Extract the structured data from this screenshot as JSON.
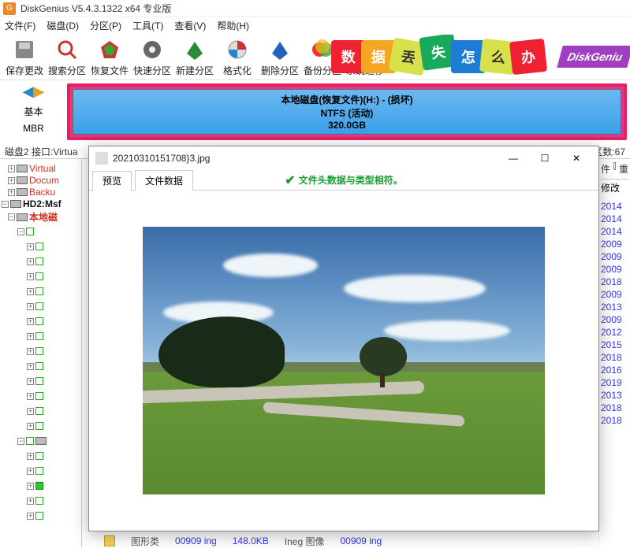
{
  "app": {
    "title": "DiskGenius V5.4.3.1322 x64 专业版"
  },
  "menu": {
    "file": "文件(F)",
    "disk": "磁盘(D)",
    "part": "分区(P)",
    "tool": "工具(T)",
    "view": "查看(V)",
    "help": "帮助(H)"
  },
  "toolbar": {
    "save": "保存更改",
    "search": "搜索分区",
    "recover": "恢复文件",
    "quick": "快速分区",
    "newp": "新建分区",
    "format": "格式化",
    "delete": "删除分区",
    "backup": "备份分区",
    "migrate": "系统迁移"
  },
  "banner": {
    "t1": "数",
    "t2": "据",
    "t3": "丢",
    "t4": "失",
    "t5": "怎",
    "t6": "么",
    "t7": "办",
    "dg": "DiskGeniu"
  },
  "left": {
    "basic": "基本",
    "mbr": "MBR"
  },
  "disk": {
    "name": "本地磁盘(恢复文件)(H:) - (损坏)",
    "fs": "NTFS (活动)",
    "size": "320.0GB"
  },
  "status": {
    "left": "磁盘2 接口:Virtua",
    "right": "扇区数:67"
  },
  "tree": {
    "items": [
      {
        "label": "Virtual",
        "cls": "vir"
      },
      {
        "label": "Docum",
        "cls": "doc"
      },
      {
        "label": "Backu",
        "cls": "bak"
      }
    ],
    "hd2": "HD2:Msf",
    "local": "本地磁"
  },
  "right": {
    "hdr1": "件",
    "hdr2": "重",
    "mod": "修改",
    "years": [
      "2014",
      "2014",
      "2014",
      "2009",
      "2009",
      "2009",
      "2018",
      "2009",
      "2013",
      "2009",
      "2012",
      "2015",
      "2018",
      "2016",
      "2019",
      "2013",
      "2018",
      "2018"
    ]
  },
  "preview": {
    "filename": "20210310151708}3.jpg",
    "tab1": "预览",
    "tab2": "文件数据",
    "message": "文件头数据与类型相符。"
  },
  "bottom": {
    "folder": "图形类",
    "file": "00909 ing",
    "size": "148.0KB",
    "type": "Ineg 图像",
    "file2": "00909 ing"
  }
}
